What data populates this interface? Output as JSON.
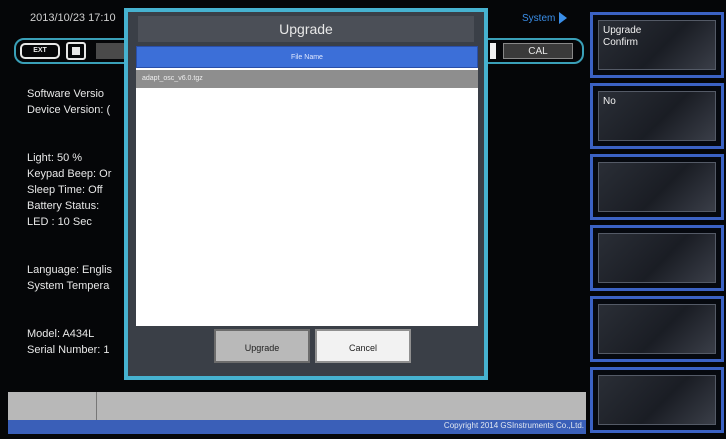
{
  "header": {
    "datetime": "2013/10/23 17:10",
    "system_label": "System",
    "mode_ext": "EXT",
    "cal_label": "CAL"
  },
  "info": {
    "software_version": "Software Versio",
    "device_version": "Device Version: (",
    "light": "Light: 50 %",
    "keypad_beep": "Keypad Beep: Or",
    "sleep_time": "Sleep Time: Off",
    "battery_status": "Battery Status:",
    "led": "LED : 10 Sec",
    "language": "Language: Englis",
    "system_temp": "System Tempera",
    "model": "Model: A434L",
    "serial_number": "Serial Number: 1"
  },
  "softkeys": [
    {
      "label": "Upgrade\nConfirm"
    },
    {
      "label": "No"
    },
    {
      "label": ""
    },
    {
      "label": ""
    },
    {
      "label": ""
    },
    {
      "label": ""
    }
  ],
  "dialog": {
    "title": "Upgrade",
    "file_header": "File Name",
    "files": [
      "adapt_osc_v6.0.tgz"
    ],
    "upgrade_button": "Upgrade",
    "cancel_button": "Cancel"
  },
  "footer": {
    "copyright": "Copyright 2014 GSInstruments Co.,Ltd."
  }
}
